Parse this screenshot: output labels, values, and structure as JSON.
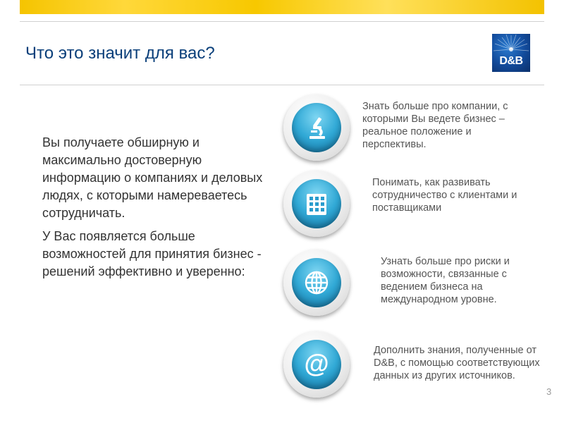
{
  "slide": {
    "title": "Что это значит для вас?",
    "logo_text": "D&B",
    "page_number": "3"
  },
  "left_text": {
    "paragraph_1": "Вы получаете обширную и максимально достоверную информацию о компаниях и деловых людях, с которыми намереваетесь сотрудничать.",
    "paragraph_2": "У Вас появляется больше возможностей для принятия бизнес - решений эффективно и уверенно:"
  },
  "points": [
    {
      "icon": "microscope-icon",
      "text": "Знать больше про компании, с которыми Вы ведете бизнес – реальное положение и перспективы."
    },
    {
      "icon": "building-icon",
      "text": "Понимать, как развивать сотрудничество с клиентами и поставщиками"
    },
    {
      "icon": "globe-icon",
      "text": "Узнать больше про риски и возможности, связанные с ведением бизнеса на международном уровне."
    },
    {
      "icon": "at-sign-icon",
      "text": "Дополнить знания, полученные от D&B, с помощью соответствующих данных из других источников."
    }
  ],
  "colors": {
    "title": "#0a3f7a",
    "band": "#f5c400",
    "icon_blue": "#31a9d6",
    "logo_blue": "#124a9a"
  }
}
